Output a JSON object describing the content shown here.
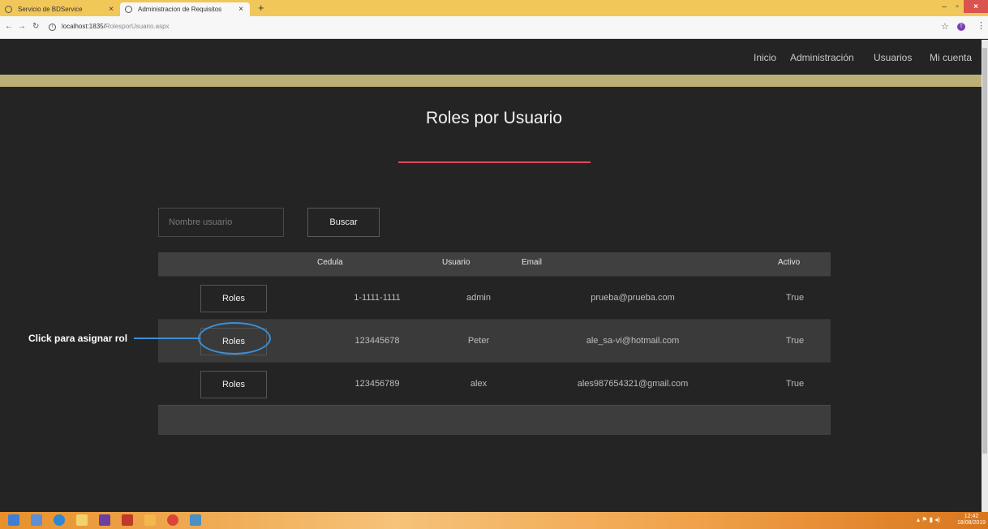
{
  "browser": {
    "tabs": [
      {
        "label": "Servicio de BDService"
      },
      {
        "label": "Administracion de Requisitos"
      }
    ],
    "url_host": "localhost:1835/",
    "url_path": "RolesporUsuario.aspx",
    "profile_initial": "T"
  },
  "nav": {
    "links": [
      "Inicio",
      "Administración",
      "Usuarios",
      "Mi cuenta"
    ]
  },
  "page": {
    "title": "Roles por Usuario"
  },
  "search": {
    "placeholder": "Nombre usuario",
    "button_label": "Buscar"
  },
  "table": {
    "headers": [
      "Cedula",
      "Usuario",
      "Email",
      "Activo"
    ],
    "rows": [
      {
        "button": "Roles",
        "cedula": "1-1111-1111",
        "usuario": "admin",
        "email": "prueba@prueba.com",
        "activo": "True"
      },
      {
        "button": "Roles",
        "cedula": "123445678",
        "usuario": "Peter",
        "email": "ale_sa-vi@hotmail.com",
        "activo": "True"
      },
      {
        "button": "Roles",
        "cedula": "123456789",
        "usuario": "alex",
        "email": "ales987654321@gmail.com",
        "activo": "True"
      }
    ]
  },
  "annotation": {
    "label": "Click para asignar rol"
  },
  "taskbar": {
    "time": "12:42",
    "date": "18/08/2019"
  },
  "colors": {
    "background": "#242424",
    "accent_band": "#bdb076",
    "title_rule": "#e0485a",
    "annotation": "#3b8fd6"
  }
}
